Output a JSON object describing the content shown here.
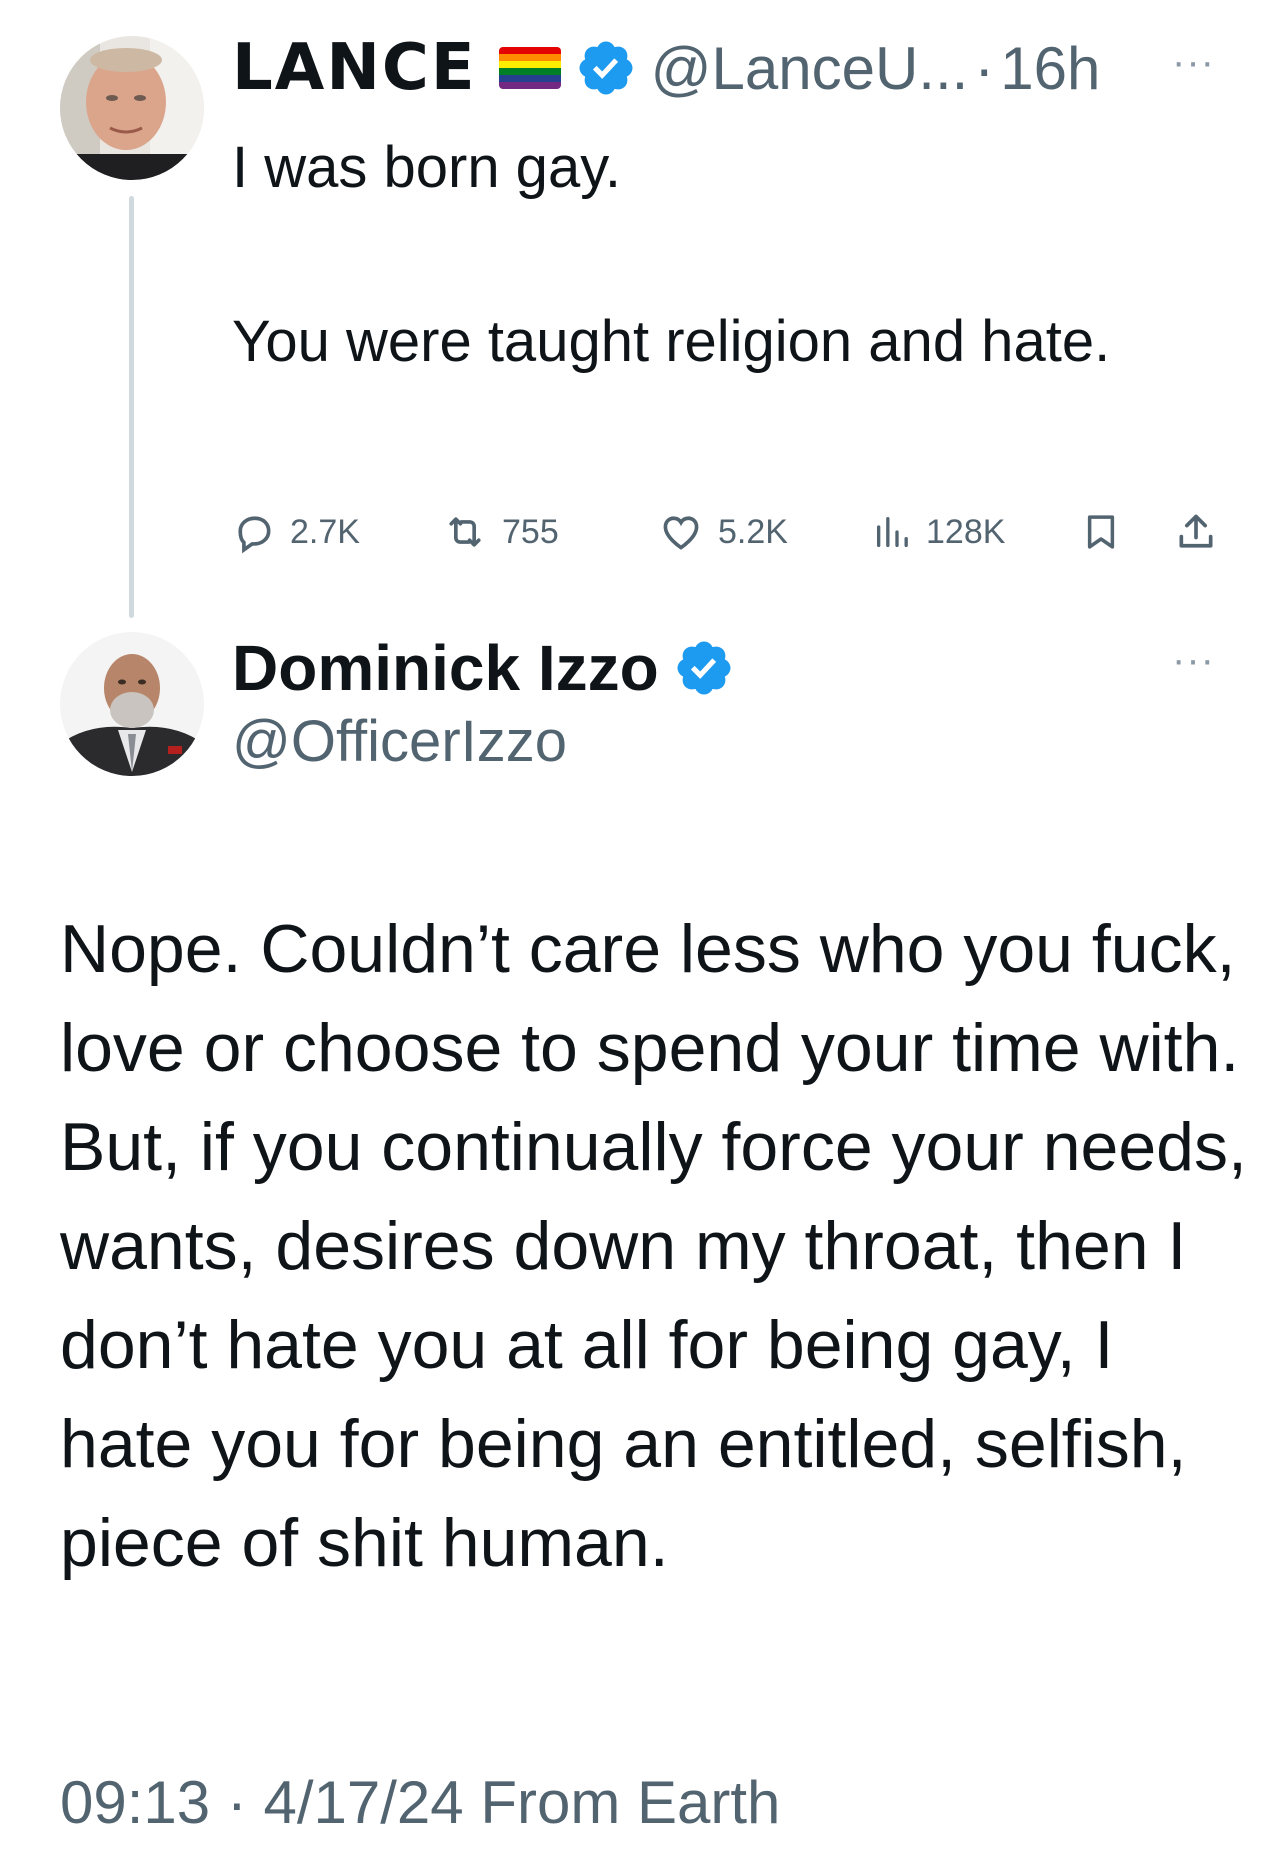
{
  "parent_tweet": {
    "display_name": "LANCE",
    "flag_emoji": "rainbow-flag",
    "verified": true,
    "handle": "@LanceU...",
    "separator": "·",
    "time": "16h",
    "more_label": "···",
    "text_lines": [
      "I was born gay.",
      "You were taught religion and hate."
    ],
    "stats": {
      "replies": "2.7K",
      "reposts": "755",
      "likes": "5.2K",
      "views": "128K"
    }
  },
  "reply_tweet": {
    "display_name": "Dominick Izzo",
    "verified": true,
    "handle": "@OfficerIzzo",
    "more_label": "···",
    "text": "Nope. Couldn’t care less who you fuck, love or choose to spend your time with. But, if you continually force your needs, wants, desires down my throat, then I don’t hate you at all for being gay, I hate you for being an entitled, selfish, piece of shit human.",
    "timestamp": "09:13 · 4/17/24 From Earth"
  },
  "colors": {
    "text_primary": "#0f1419",
    "text_secondary": "#536471",
    "verified_blue": "#1d9bf0",
    "thread_line": "#cfd9de"
  }
}
